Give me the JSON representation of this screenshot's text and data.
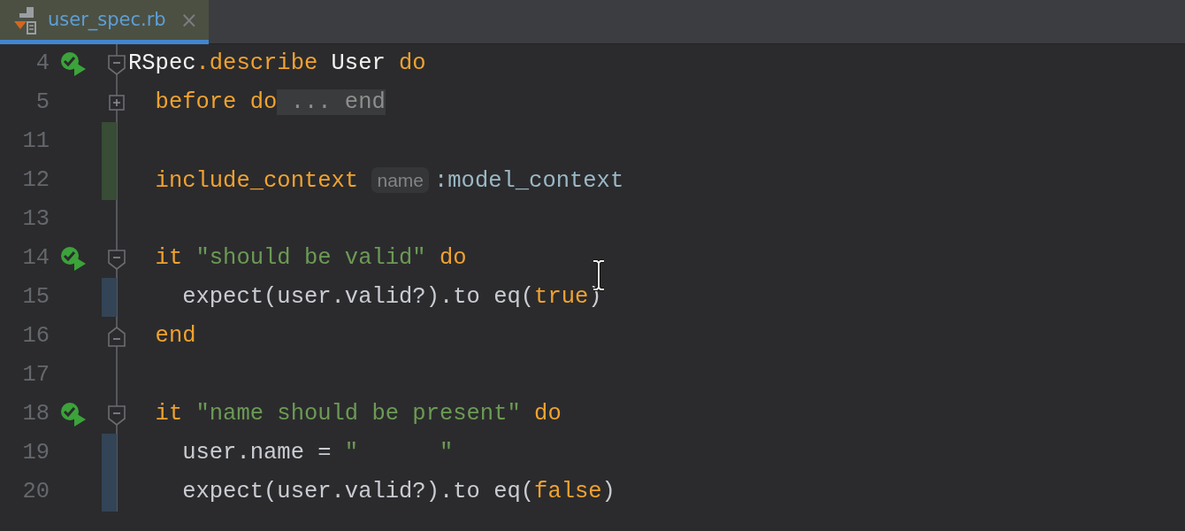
{
  "tabs": [
    {
      "label": "user_spec.rb",
      "close": "×",
      "selected": true
    }
  ],
  "lines": [
    {
      "number": "4",
      "run": true,
      "fold_start": true,
      "fold_end": false,
      "collapsed": false,
      "added": false,
      "modified": false,
      "tokens": [
        {
          "text": "RSpec",
          "kind": "const"
        },
        {
          "text": ".describe ",
          "kind": "keyword"
        },
        {
          "text": "User ",
          "kind": "const"
        },
        {
          "text": "do",
          "kind": "keyword"
        }
      ]
    },
    {
      "number": "5",
      "run": false,
      "fold_start": false,
      "fold_end": false,
      "collapsed": true,
      "added": false,
      "modified": false,
      "tokens": [
        {
          "text": "  before do",
          "kind": "keyword"
        },
        {
          "text": " ... end",
          "kind": "folded"
        }
      ]
    },
    {
      "number": "11",
      "run": false,
      "fold_start": false,
      "fold_end": false,
      "collapsed": false,
      "added": true,
      "modified": false
    },
    {
      "number": "12",
      "run": false,
      "fold_start": false,
      "fold_end": false,
      "collapsed": false,
      "added": true,
      "modified": false,
      "tokens": [
        {
          "text": "  include_context ",
          "kind": "keyword"
        },
        {
          "text": "name",
          "kind": "hint"
        },
        {
          "text": ":model_context",
          "kind": "symbol"
        }
      ]
    },
    {
      "number": "13",
      "run": false,
      "fold_start": false,
      "fold_end": false,
      "collapsed": false,
      "added": false,
      "modified": false
    },
    {
      "number": "14",
      "run": true,
      "fold_start": true,
      "fold_end": false,
      "collapsed": false,
      "added": false,
      "modified": false,
      "tokens": [
        {
          "text": "  it ",
          "kind": "keyword"
        },
        {
          "text": "\"should be valid\" ",
          "kind": "string"
        },
        {
          "text": "do",
          "kind": "keyword"
        }
      ]
    },
    {
      "number": "15",
      "run": false,
      "fold_start": false,
      "fold_end": false,
      "collapsed": false,
      "added": false,
      "modified": true,
      "tokens": [
        {
          "text": "    expect(user.valid?).to eq(",
          "kind": "plain"
        },
        {
          "text": "true",
          "kind": "keyword"
        },
        {
          "text": ")",
          "kind": "plain"
        }
      ]
    },
    {
      "number": "16",
      "run": false,
      "fold_start": false,
      "fold_end": true,
      "collapsed": false,
      "added": false,
      "modified": false,
      "tokens": [
        {
          "text": "  end",
          "kind": "keyword"
        }
      ]
    },
    {
      "number": "17",
      "run": false,
      "fold_start": false,
      "fold_end": false,
      "collapsed": false,
      "added": false,
      "modified": false
    },
    {
      "number": "18",
      "run": true,
      "fold_start": true,
      "fold_end": false,
      "collapsed": false,
      "added": false,
      "modified": false,
      "tokens": [
        {
          "text": "  it ",
          "kind": "keyword"
        },
        {
          "text": "\"name should be present\" ",
          "kind": "string"
        },
        {
          "text": "do",
          "kind": "keyword"
        }
      ]
    },
    {
      "number": "19",
      "run": false,
      "fold_start": false,
      "fold_end": false,
      "collapsed": false,
      "added": false,
      "modified": true,
      "tokens": [
        {
          "text": "    user.name = ",
          "kind": "plain"
        },
        {
          "text": "\"      \"",
          "kind": "string"
        }
      ]
    },
    {
      "number": "20",
      "run": false,
      "fold_start": false,
      "fold_end": false,
      "collapsed": false,
      "added": false,
      "modified": true,
      "tokens": [
        {
          "text": "    expect(user.valid?).to eq(",
          "kind": "plain"
        },
        {
          "text": "false",
          "kind": "keyword"
        },
        {
          "text": ")",
          "kind": "plain"
        }
      ]
    }
  ]
}
